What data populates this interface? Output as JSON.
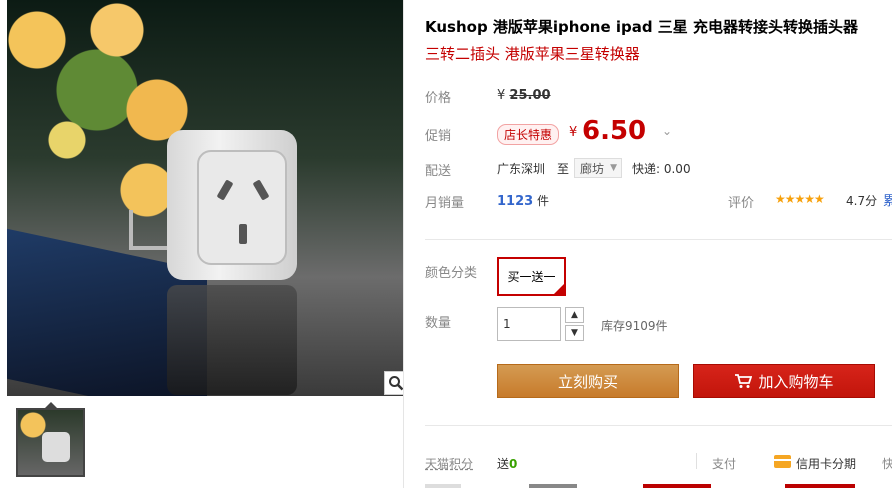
{
  "product": {
    "title": "Kushop 港版苹果iphone ipad 三星 充电器转接头转换插头器",
    "subtitle": "三转二插头 港版苹果三星转换器"
  },
  "price": {
    "label": "价格",
    "currency": "¥",
    "original": "25.00"
  },
  "promo": {
    "label": "促销",
    "badge": "店长特惠",
    "currency": "¥",
    "price": "6.50",
    "caret": "⌄"
  },
  "shipping": {
    "label": "配送",
    "from": "广东深圳",
    "to_label": "至",
    "to_value": "廊坊",
    "express": "快递: 0.00"
  },
  "sales": {
    "label": "月销量",
    "count": "1123",
    "unit": "件"
  },
  "rating": {
    "label": "评价",
    "stars": "★★★★★",
    "score": "4.7分",
    "more": "累"
  },
  "sku": {
    "label": "颜色分类",
    "options": [
      "买一送一"
    ]
  },
  "quantity": {
    "label": "数量",
    "value": "1",
    "stock": "库存9109件"
  },
  "actions": {
    "buy_now": "立刻购买",
    "add_to_cart": "加入购物车"
  },
  "points": {
    "label": "天猫积分",
    "value_prefix": "送",
    "value": "0"
  },
  "payment": {
    "label": "支付",
    "method": "信用卡分期",
    "more": "快"
  },
  "colors": {
    "price_red": "#c40000",
    "buy_orange": "#c77b2b",
    "cart_red": "#c2150b",
    "link_blue": "#3366cc",
    "star_orange": "#f7a10c"
  }
}
